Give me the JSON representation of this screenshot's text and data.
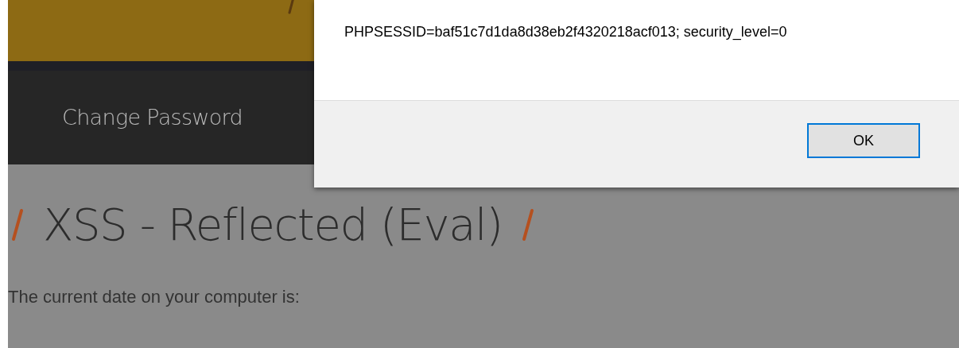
{
  "nav": {
    "items": [
      {
        "label": "Change Password"
      }
    ]
  },
  "heading": "XSS - Reflected (Eval)",
  "paragraph": "The current date on your computer is:",
  "dialog": {
    "message": "PHPSESSID=baf51c7d1da8d38eb2f4320218acf013; security_level=0",
    "buttons": [
      {
        "label": "OK",
        "focused": true
      }
    ]
  }
}
